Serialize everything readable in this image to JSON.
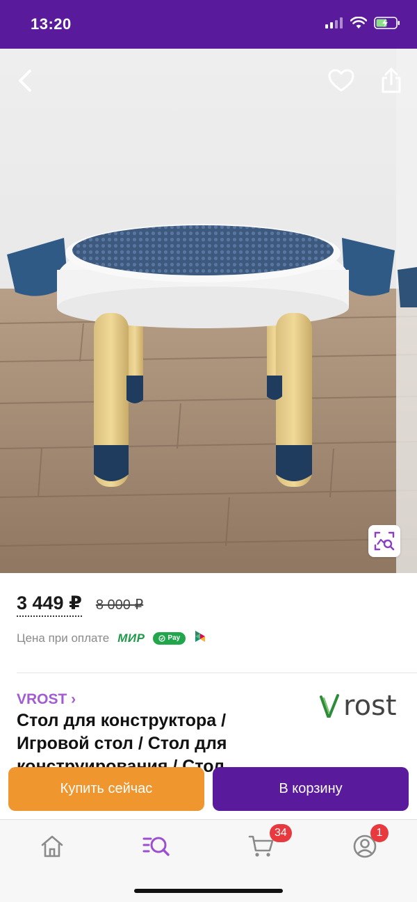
{
  "status_bar": {
    "time": "13:20"
  },
  "product": {
    "price_current": "3 449 ₽",
    "price_old": "8 000 ₽",
    "payment_label": "Цена при оплате",
    "mir_label": "МИР",
    "spay_label": "Pay",
    "brand_link": "VROST ›",
    "brand_logo_text": "rost",
    "title": "Стол для конструктора / Игровой стол / Стол для конструирования / Стол конструктор"
  },
  "actions": {
    "buy_now": "Купить сейчас",
    "add_to_cart": "В корзину"
  },
  "tab_bar": {
    "cart_badge": "34",
    "profile_badge": "1",
    "items": [
      "home-icon",
      "catalog-search-icon",
      "cart-icon",
      "profile-icon"
    ]
  },
  "colors": {
    "brand_purple": "#5a1a9c",
    "buy_orange": "#f0962e",
    "brand_link": "#a35bd1",
    "badge_red": "#e8393e"
  }
}
